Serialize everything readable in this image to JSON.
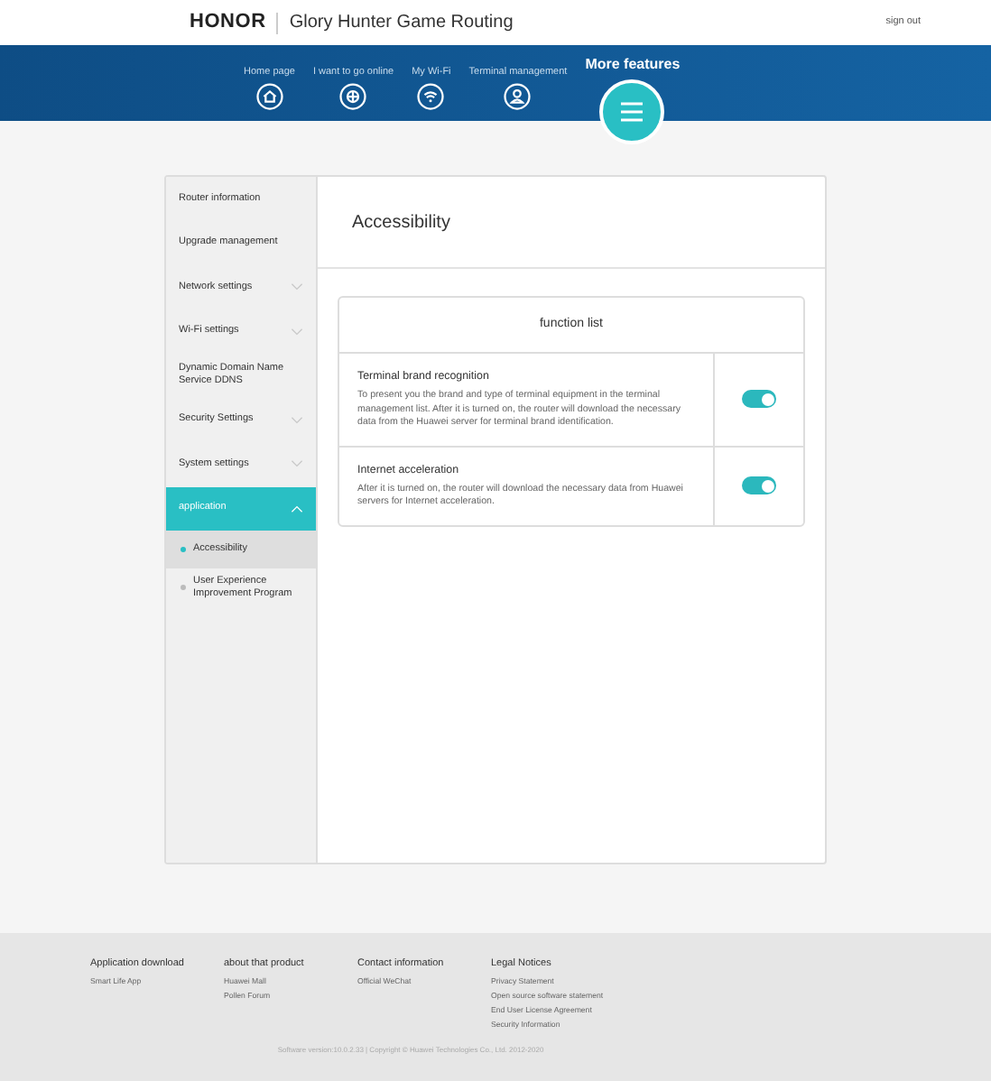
{
  "header": {
    "brand": "HONOR",
    "title": "Glory Hunter Game Routing",
    "sign_out": "sign out"
  },
  "nav": [
    {
      "label": "Home page",
      "selected": false
    },
    {
      "label": "I want to go online",
      "selected": false
    },
    {
      "label": "My Wi-Fi",
      "selected": false
    },
    {
      "label": "Terminal management",
      "selected": false
    },
    {
      "label": "More features",
      "selected": true
    }
  ],
  "sidebar": {
    "items": [
      {
        "label": "Router information",
        "kind": "plain"
      },
      {
        "label": "Upgrade management",
        "kind": "plain"
      },
      {
        "label": "Network settings",
        "kind": "group",
        "expanded": false,
        "selected": false
      },
      {
        "label": "Wi-Fi settings",
        "kind": "group",
        "expanded": false,
        "selected": false
      },
      {
        "label": "Dynamic Domain Name Service DDNS",
        "kind": "plain"
      },
      {
        "label": "Security Settings",
        "kind": "group",
        "expanded": false,
        "selected": false
      },
      {
        "label": "System settings",
        "kind": "group",
        "expanded": false,
        "selected": false
      },
      {
        "label": "application",
        "kind": "group",
        "expanded": true,
        "selected": true,
        "children": [
          {
            "label": "Accessibility",
            "selected": true
          },
          {
            "label": "User Experience Improvement Program",
            "selected": false
          }
        ]
      }
    ]
  },
  "content": {
    "title": "Accessibility",
    "table": {
      "heading": "function list",
      "rows": [
        {
          "name": "Terminal brand recognition",
          "description": "To present you the brand and type of terminal equipment in the terminal management list. After it is turned on, the router will download the necessary data from the Huawei server for terminal brand identification.",
          "on": true
        },
        {
          "name": "Internet acceleration",
          "description": "After it is turned on, the router will download the necessary data from Huawei servers for Internet acceleration.",
          "on": true
        }
      ]
    }
  },
  "footer": {
    "columns": [
      {
        "heading": "Application download",
        "links": [
          "Smart Life App"
        ]
      },
      {
        "heading": "about that product",
        "links": [
          "Huawei Mall",
          "Pollen Forum"
        ]
      },
      {
        "heading": "Contact information",
        "links": [
          "Official WeChat"
        ]
      },
      {
        "heading": "Legal Notices",
        "links": [
          "Privacy Statement",
          "Open source software statement",
          "End User License Agreement",
          "Security Information"
        ]
      }
    ],
    "copyright": "Software version:10.0.2.33 | Copyright © Huawei Technologies Co., Ltd. 2012-2020"
  }
}
